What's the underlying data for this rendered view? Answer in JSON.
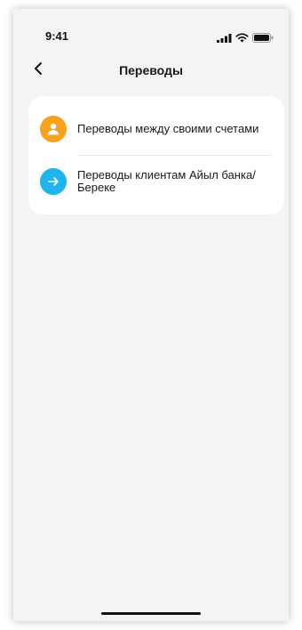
{
  "status_bar": {
    "time": "9:41",
    "icons": [
      "signal-icon",
      "wifi-icon",
      "battery-icon"
    ]
  },
  "header": {
    "back_icon": "chevron-left-icon",
    "title": "Переводы"
  },
  "menu": {
    "items": [
      {
        "label": "Переводы между своими счетами",
        "icon": "user-icon",
        "icon_color": "#f7a11d"
      },
      {
        "label": "Переводы клиентам Айыл банка/Береке",
        "icon": "arrow-right-icon",
        "icon_color": "#1fb3ef"
      }
    ]
  },
  "colors": {
    "background": "#f4f4f5",
    "card": "#ffffff",
    "text": "#1a1a1a"
  }
}
